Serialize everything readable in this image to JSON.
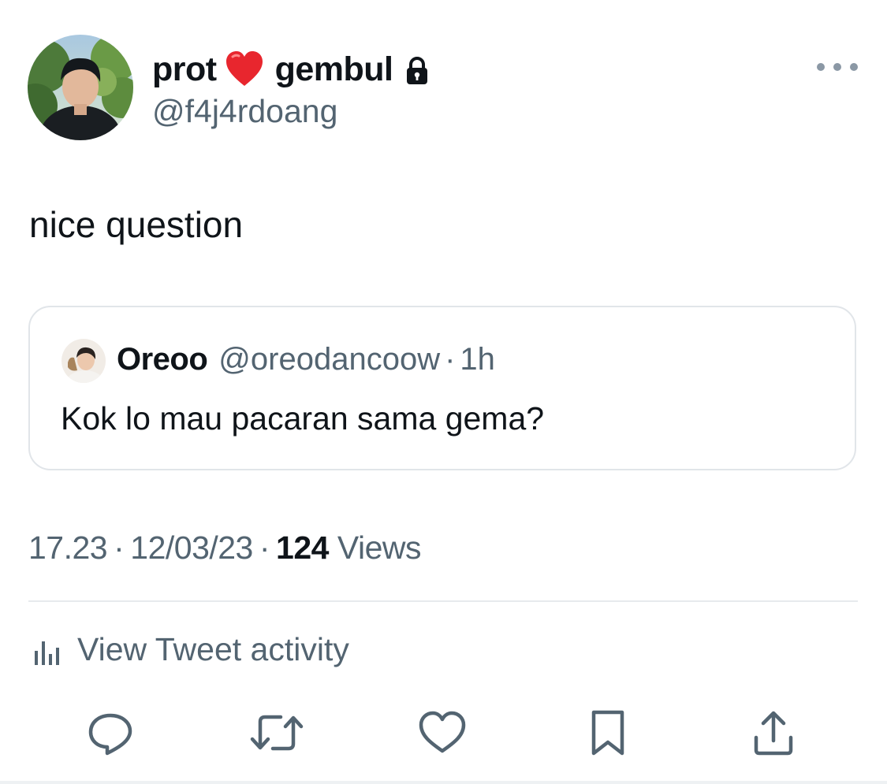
{
  "author": {
    "name_first": "prot",
    "name_second": "gembul",
    "name_emoji": "heart-emoji",
    "protected_icon": "lock-icon",
    "handle": "@f4j4rdoang",
    "avatar_icon": "avatar-photo"
  },
  "tweet": {
    "text": "nice question"
  },
  "quoted_tweet": {
    "author_name": "Oreoo",
    "author_handle": "@oreodancoow",
    "separator": "·",
    "time": "1h",
    "text": "Kok lo mau pacaran sama gema?",
    "avatar_icon": "avatar-photo"
  },
  "meta": {
    "time": "17.23",
    "separator": "·",
    "date": "12/03/23",
    "views_count": "124",
    "views_label": "Views"
  },
  "activity": {
    "label": "View Tweet activity",
    "icon": "bar-chart-icon"
  },
  "actions": [
    {
      "name": "reply",
      "icon": "reply-icon"
    },
    {
      "name": "retweet",
      "icon": "retweet-icon"
    },
    {
      "name": "like",
      "icon": "heart-icon"
    },
    {
      "name": "bookmark",
      "icon": "bookmark-icon"
    },
    {
      "name": "share",
      "icon": "share-icon"
    }
  ],
  "colors": {
    "text": "#0f1419",
    "secondary": "#536471",
    "border": "#e1e5e9",
    "heart": "#e0245e"
  }
}
